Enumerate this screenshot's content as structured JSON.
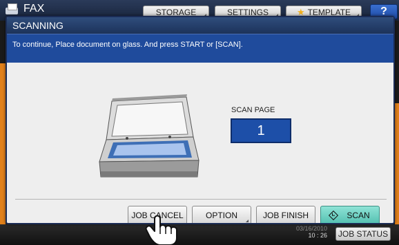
{
  "background": {
    "app_title": "FAX",
    "tabs": [
      "STORAGE",
      "SETTINGS",
      "TEMPLATE"
    ],
    "help_label": "?",
    "clock_date": "03/16/2010",
    "clock_time": "10 : 26",
    "job_status_label": "JOB STATUS"
  },
  "dialog": {
    "title": "SCANNING",
    "message": "To continue, Place document on glass. And press START or [SCAN].",
    "scan_page_label": "SCAN PAGE",
    "scan_page_count": "1",
    "buttons": {
      "job_cancel": "JOB CANCEL",
      "option": "OPTION",
      "job_finish": "JOB FINISH",
      "scan": "SCAN"
    }
  },
  "colors": {
    "title_bar": "#1c325a",
    "message_bar": "#1f4b9c",
    "scan_button": "#52bfb0",
    "accent_orange": "#e0801a"
  },
  "icons": [
    "fax-icon",
    "star-icon",
    "scanner-illustration",
    "start-diamond-icon",
    "pointing-hand-icon"
  ]
}
